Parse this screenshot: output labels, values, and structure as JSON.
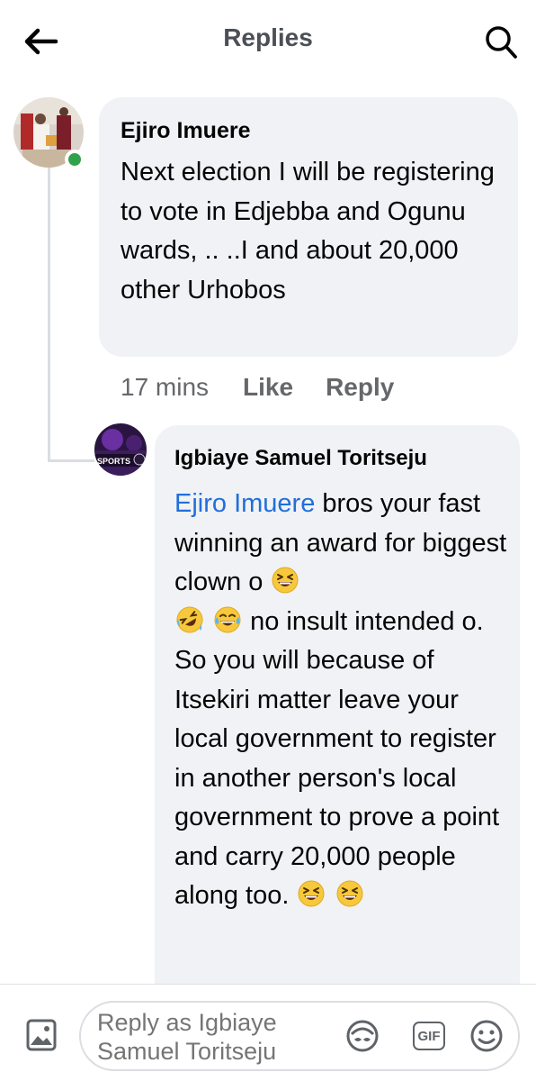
{
  "header": {
    "title": "Replies",
    "back_icon": "arrow-left-icon",
    "search_icon": "search-icon"
  },
  "comment": {
    "author": "Ejiro Imuere",
    "text": "Next election I will be registering to vote in Edjebba and Ogunu wards, .. ..I and about 20,000 other Urhobos",
    "time": "17 mins",
    "like_label": "Like",
    "reply_label": "Reply",
    "online": true
  },
  "reply": {
    "author": "Igbiaye Samuel Toritseju",
    "mention": "Ejiro Imuere",
    "text_1": " bros your fast winning an award for biggest clown o",
    "text_2": " no insult intended o.",
    "text_3": "So you will because of Itsekiri matter leave your local government to register in another person's local government to prove a point and carry 20,000 people along too.",
    "avatar_badge": "SPORTS"
  },
  "composer": {
    "placeholder": "Reply as Igbiaye Samuel Toritseju",
    "gif_label": "GIF"
  },
  "colors": {
    "mention": "#216fdb",
    "bubble": "#f0f2f5",
    "online": "#31a24c",
    "secondary_text": "#65676b"
  }
}
